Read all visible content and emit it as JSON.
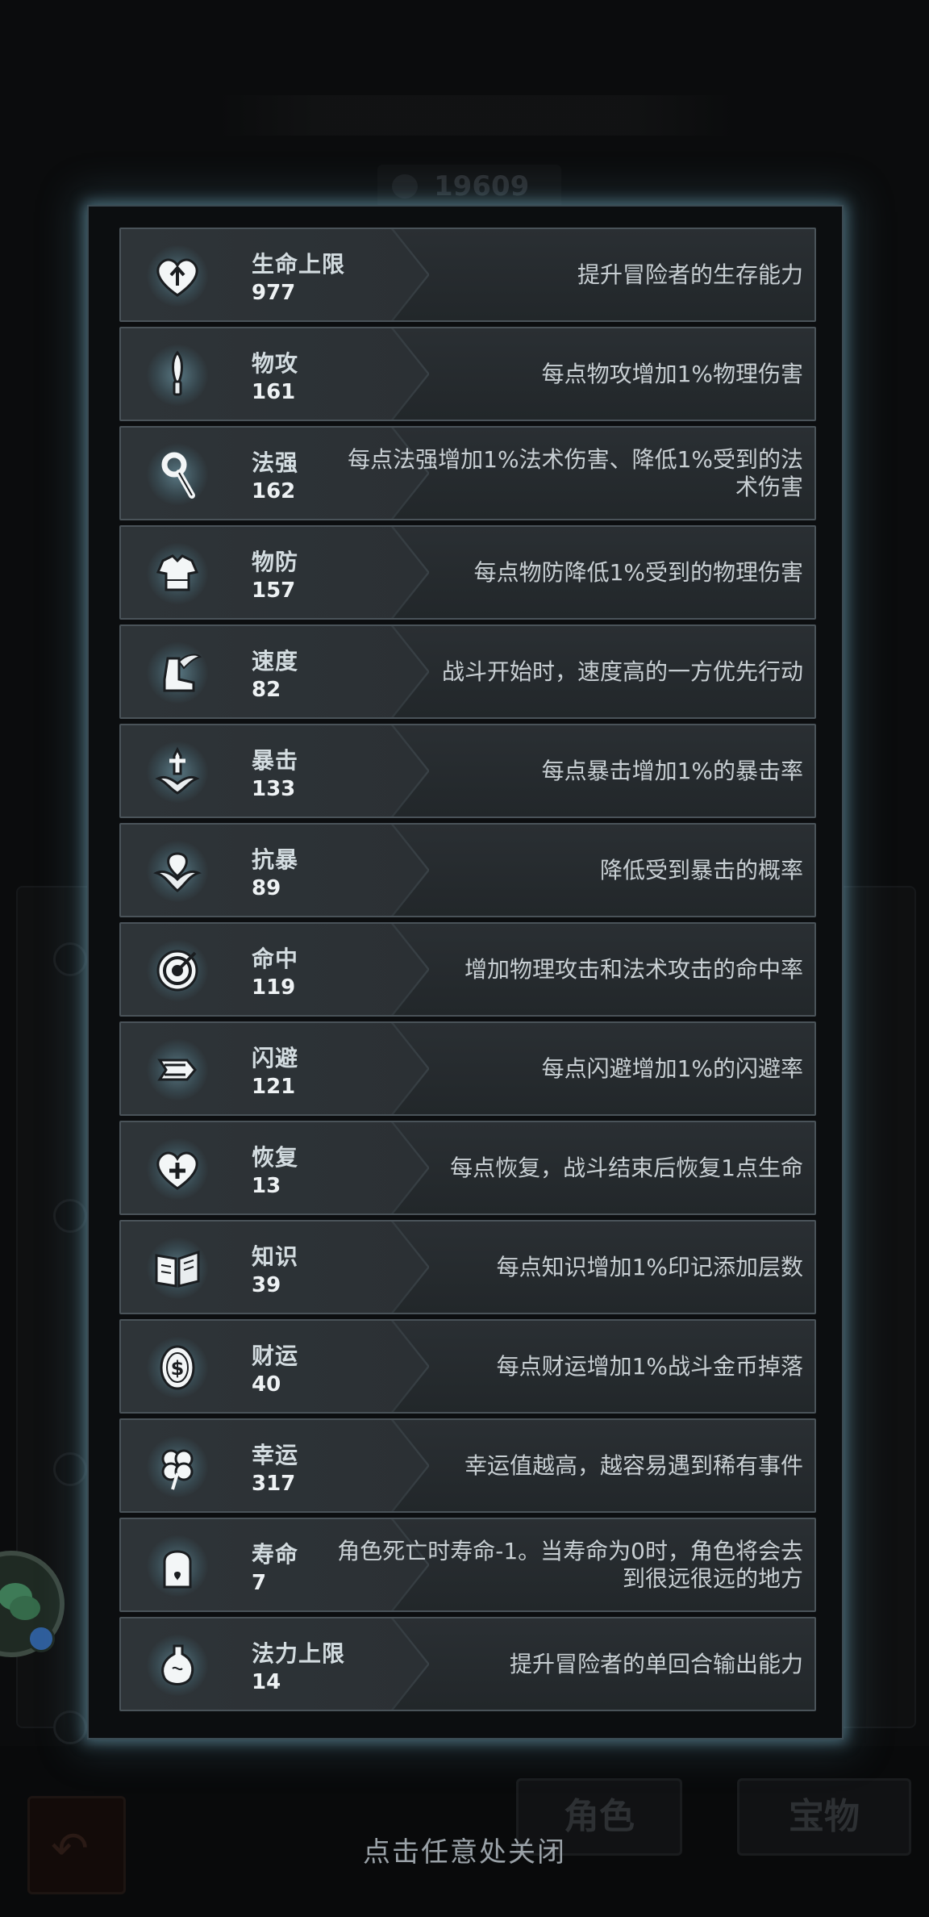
{
  "background": {
    "score": "19609",
    "tabs": [
      "角色",
      "宝物"
    ]
  },
  "stats": [
    {
      "name": "生命上限",
      "value": "977",
      "desc": "提升冒险者的生存能力",
      "icon": "heart-arrow-icon"
    },
    {
      "name": "物攻",
      "value": "161",
      "desc": "每点物攻增加1%物理伤害",
      "icon": "sword-icon"
    },
    {
      "name": "法强",
      "value": "162",
      "desc": "每点法强增加1%法术伤害、降低1%受到的法术伤害",
      "icon": "staff-icon"
    },
    {
      "name": "物防",
      "value": "157",
      "desc": "每点物防降低1%受到的物理伤害",
      "icon": "armor-icon"
    },
    {
      "name": "速度",
      "value": "82",
      "desc": "战斗开始时，速度高的一方优先行动",
      "icon": "winged-boot-icon"
    },
    {
      "name": "暴击",
      "value": "133",
      "desc": "每点暴击增加1%的暴击率",
      "icon": "crit-sword-icon"
    },
    {
      "name": "抗暴",
      "value": "89",
      "desc": "降低受到暴击的概率",
      "icon": "crit-shield-icon"
    },
    {
      "name": "命中",
      "value": "119",
      "desc": "增加物理攻击和法术攻击的命中率",
      "icon": "target-icon"
    },
    {
      "name": "闪避",
      "value": "121",
      "desc": "每点闪避增加1%的闪避率",
      "icon": "dodge-arrows-icon"
    },
    {
      "name": "恢复",
      "value": "13",
      "desc": "每点恢复，战斗结束后恢复1点生命",
      "icon": "heart-plus-icon"
    },
    {
      "name": "知识",
      "value": "39",
      "desc": "每点知识增加1%印记添加层数",
      "icon": "book-icon"
    },
    {
      "name": "财运",
      "value": "40",
      "desc": "每点财运增加1%战斗金币掉落",
      "icon": "coin-icon"
    },
    {
      "name": "幸运",
      "value": "317",
      "desc": "幸运值越高，越容易遇到稀有事件",
      "icon": "clover-icon"
    },
    {
      "name": "寿命",
      "value": "7",
      "desc": "角色死亡时寿命-1。当寿命为0时，角色将会去到很远很远的地方",
      "icon": "tombstone-icon"
    },
    {
      "name": "法力上限",
      "value": "14",
      "desc": "提升冒险者的单回合输出能力",
      "icon": "mana-flask-icon"
    }
  ],
  "close_hint": "点击任意处关闭"
}
